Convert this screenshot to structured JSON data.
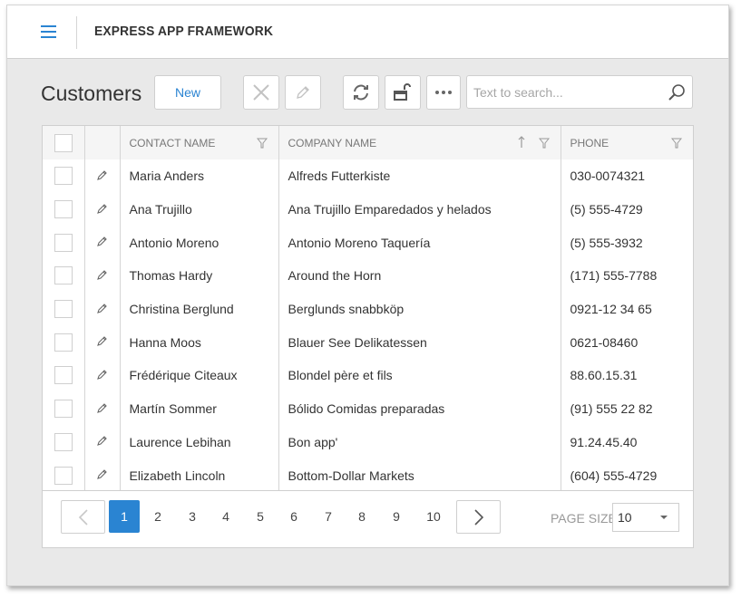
{
  "header": {
    "app_title": "EXPRESS APP FRAMEWORK",
    "accent_color": "#2a84d2"
  },
  "toolbar": {
    "page_title": "Customers",
    "new_label": "New",
    "icons": [
      "delete-icon",
      "edit-icon",
      "refresh-icon",
      "lock-icon",
      "more-icon"
    ],
    "search_placeholder": "Text to search...",
    "search_value": ""
  },
  "grid": {
    "columns": [
      {
        "label": "CONTACT NAME",
        "filter": true,
        "sort": null
      },
      {
        "label": "COMPANY NAME",
        "filter": true,
        "sort": "ascending"
      },
      {
        "label": "PHONE",
        "filter": true,
        "sort": null
      }
    ],
    "rows": [
      {
        "contact": "Maria Anders",
        "company": "Alfreds Futterkiste",
        "phone": "030-0074321"
      },
      {
        "contact": "Ana Trujillo",
        "company": "Ana Trujillo Emparedados y helados",
        "phone": "(5) 555-4729"
      },
      {
        "contact": "Antonio Moreno",
        "company": "Antonio Moreno Taquería",
        "phone": "(5) 555-3932"
      },
      {
        "contact": "Thomas Hardy",
        "company": "Around the Horn",
        "phone": "(171) 555-7788"
      },
      {
        "contact": "Christina Berglund",
        "company": "Berglunds snabbköp",
        "phone": "0921-12 34 65"
      },
      {
        "contact": "Hanna Moos",
        "company": "Blauer See Delikatessen",
        "phone": "0621-08460"
      },
      {
        "contact": "Frédérique Citeaux",
        "company": "Blondel père et fils",
        "phone": "88.60.15.31"
      },
      {
        "contact": "Martín Sommer",
        "company": "Bólido Comidas preparadas",
        "phone": "(91) 555 22 82"
      },
      {
        "contact": "Laurence Lebihan",
        "company": "Bon app'",
        "phone": "91.24.45.40"
      },
      {
        "contact": "Elizabeth Lincoln",
        "company": "Bottom-Dollar Markets",
        "phone": "(604) 555-4729"
      }
    ]
  },
  "pager": {
    "pages": [
      "1",
      "2",
      "3",
      "4",
      "5",
      "6",
      "7",
      "8",
      "9",
      "10"
    ],
    "current_page": "1",
    "page_size_label": "PAGE SIZE",
    "page_size_value": "10"
  }
}
